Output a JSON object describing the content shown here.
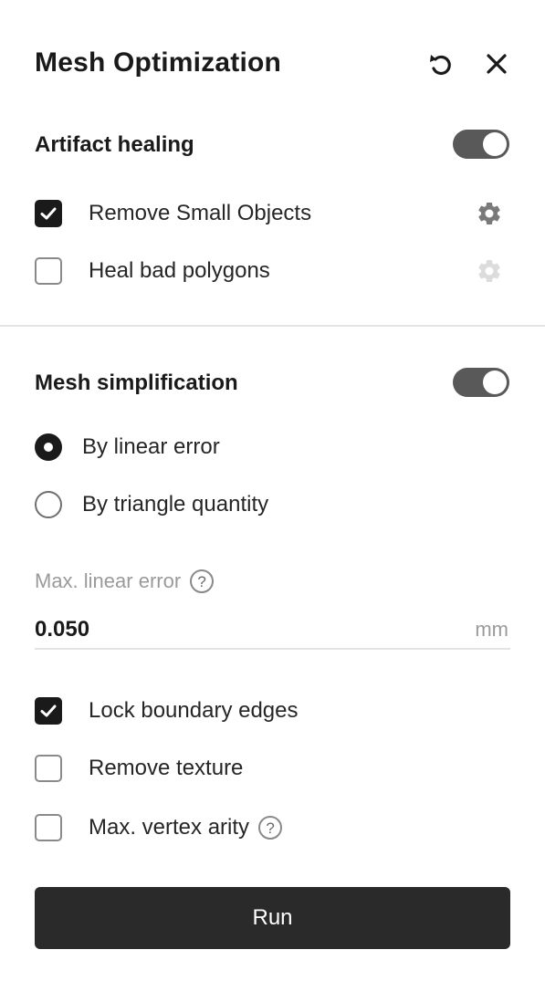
{
  "header": {
    "title": "Mesh Optimization",
    "reset_icon": "undo-icon",
    "close_icon": "close-icon"
  },
  "artifact_healing": {
    "title": "Artifact healing",
    "enabled": true,
    "options": [
      {
        "label": "Remove Small Objects",
        "checked": true,
        "settings_icon": "gear-icon",
        "settings_enabled": true
      },
      {
        "label": "Heal bad polygons",
        "checked": false,
        "settings_icon": "gear-icon",
        "settings_enabled": false
      }
    ]
  },
  "mesh_simplification": {
    "title": "Mesh simplification",
    "enabled": true,
    "modes": [
      {
        "label": "By linear error",
        "selected": true
      },
      {
        "label": "By triangle quantity",
        "selected": false
      }
    ],
    "max_linear_error": {
      "label": "Max. linear error",
      "value": "0.050",
      "unit": "mm",
      "help_icon": "question-circle-icon",
      "help_glyph": "?"
    },
    "options": [
      {
        "label": "Lock boundary edges",
        "checked": true
      },
      {
        "label": "Remove texture",
        "checked": false
      },
      {
        "label": "Max. vertex arity",
        "checked": false,
        "help_glyph": "?"
      }
    ]
  },
  "run_button": {
    "label": "Run"
  },
  "colors": {
    "toggle_on": "#595959",
    "checkbox_on": "#1a1a1a",
    "run_button_bg": "#2a2a2a",
    "muted_text": "#9a9a9a",
    "divider": "#e3e3e3"
  }
}
